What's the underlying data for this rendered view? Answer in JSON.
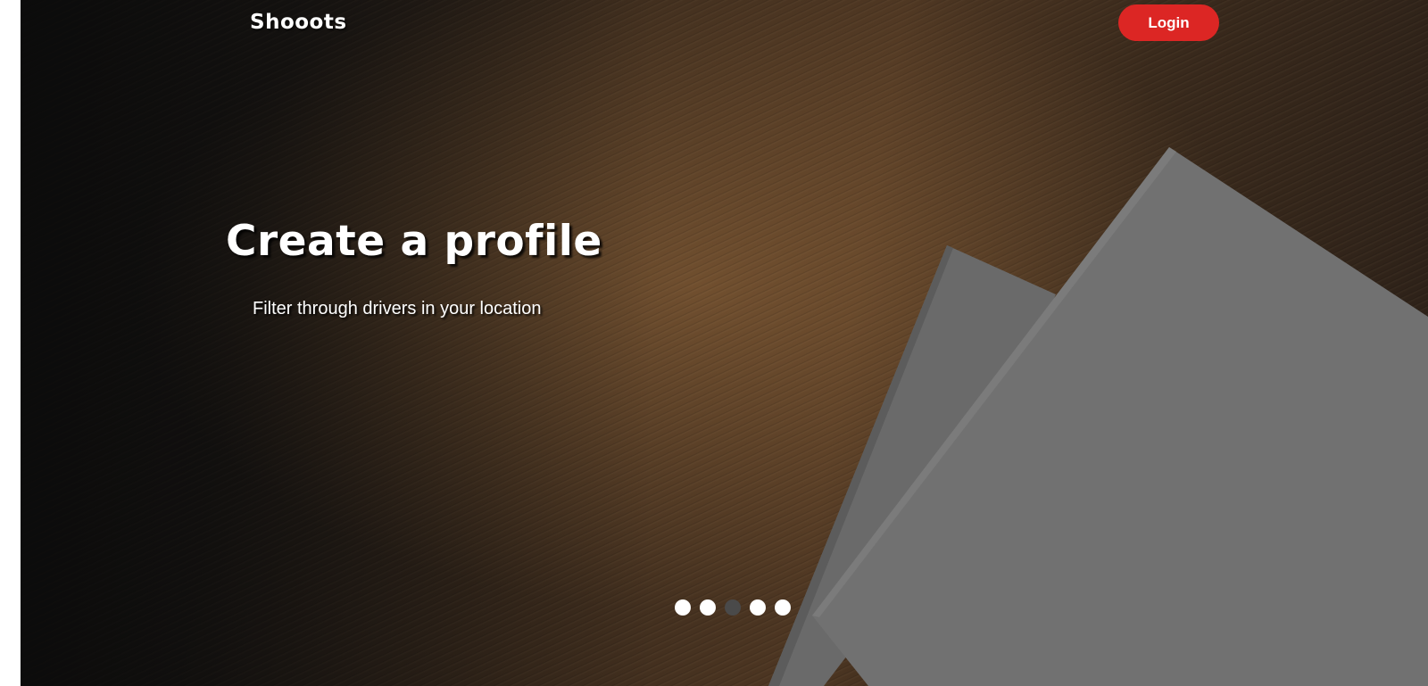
{
  "header": {
    "brand": "Shooots",
    "login_label": "Login"
  },
  "hero": {
    "title": "Create a profile",
    "subtitle": "Filter through drivers in your location"
  },
  "carousel": {
    "slide_count": 5,
    "active_index": 2
  },
  "colors": {
    "accent": "#dc2624",
    "text": "#ffffff",
    "active_dot": "#4a4a4a",
    "paper": "#717171"
  }
}
